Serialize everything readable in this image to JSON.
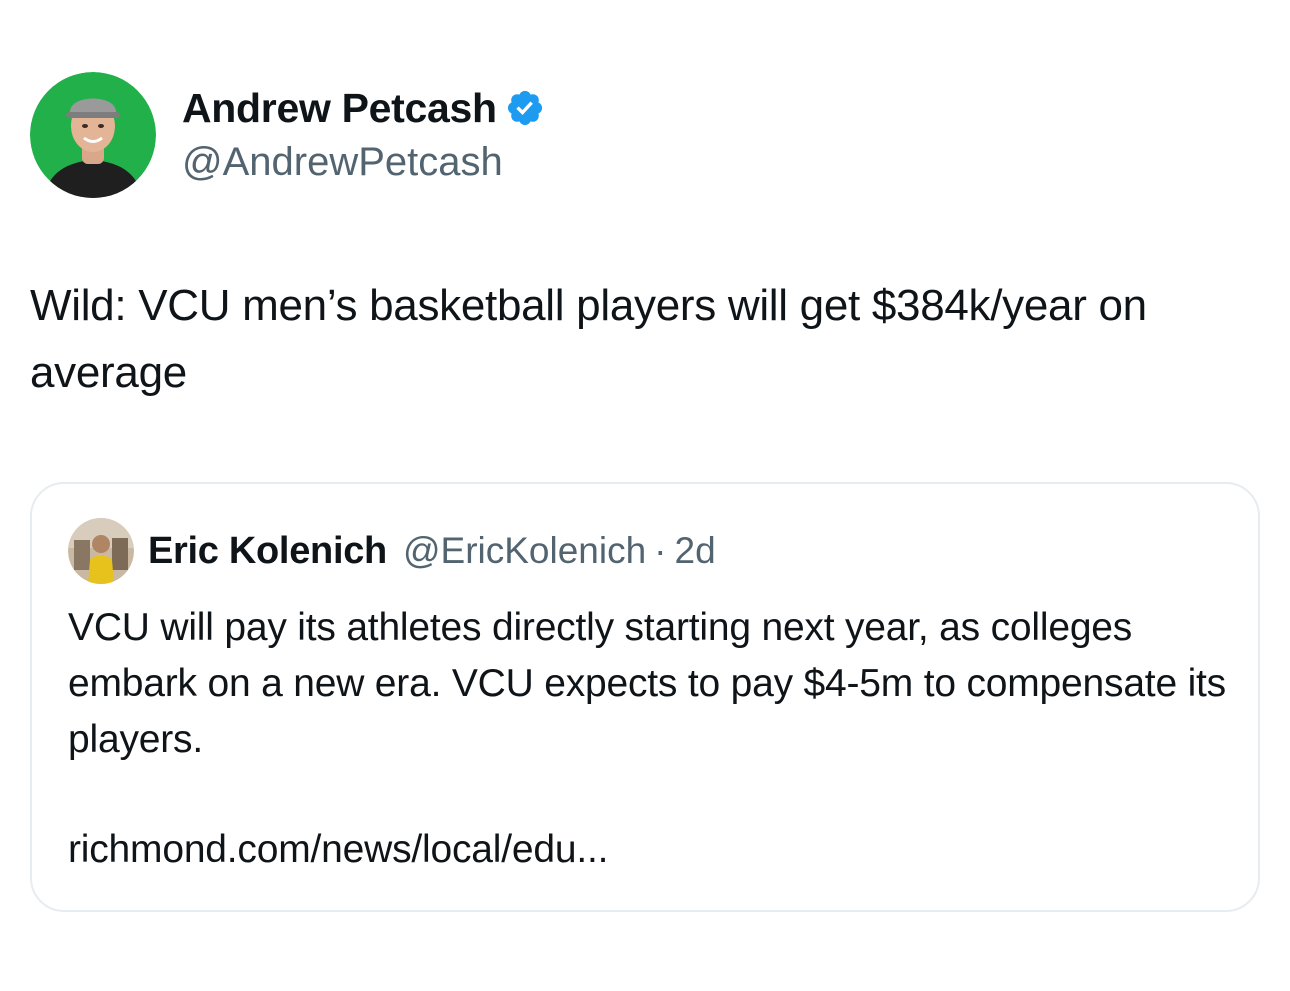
{
  "author": {
    "display_name": "Andrew Petcash",
    "handle": "@AndrewPetcash",
    "verified_icon": "verified-badge-icon",
    "avatar_bg": "#22b04a"
  },
  "tweet": {
    "text": "Wild: VCU men’s basketball players will get $384k/year on average"
  },
  "quoted_tweet": {
    "display_name": "Eric Kolenich",
    "handle": "@EricKolenich",
    "separator": "·",
    "time": "2d",
    "text": "VCU will pay its athletes directly starting next year, as colleges embark on a new era. VCU expects to pay $4-5m to compensate its players.",
    "link": "richmond.com/news/local/edu..."
  },
  "colors": {
    "text_primary": "#0f1419",
    "text_secondary": "#536471",
    "verified_blue": "#1d9bf0",
    "quote_border": "#e6ecf0"
  }
}
